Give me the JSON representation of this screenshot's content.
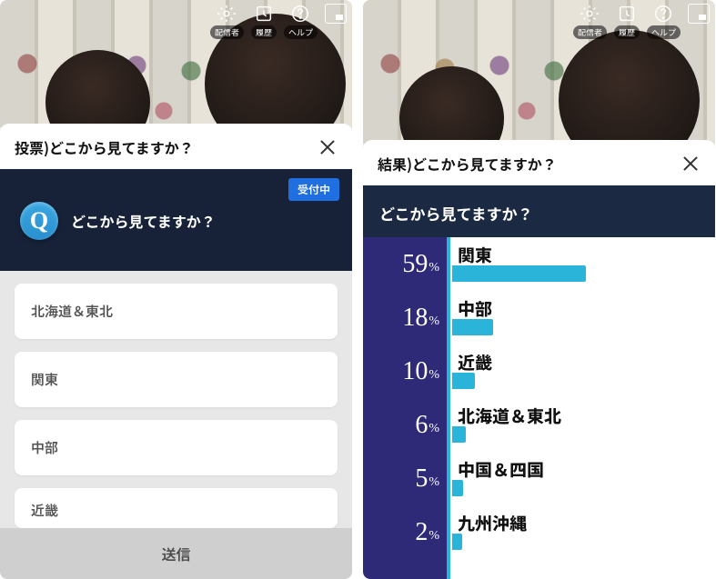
{
  "top_icons": {
    "broadcaster_label": "配信者",
    "history_label": "履歴",
    "help_label": "ヘルプ"
  },
  "left": {
    "sheet_title": "投票)どこから見てますか？",
    "badge": "受付中",
    "q_letter": "Q",
    "question": "どこから見てますか？",
    "options": [
      "北海道＆東北",
      "関東",
      "中部",
      "近畿"
    ],
    "submit": "送信"
  },
  "right": {
    "sheet_title": "結果)どこから見てますか？",
    "question": "どこから見てますか？",
    "pct_suffix": "%"
  },
  "chart_data": {
    "type": "bar",
    "title": "どこから見てますか？",
    "categories": [
      "関東",
      "中部",
      "近畿",
      "北海道＆東北",
      "中国＆四国",
      "九州沖縄"
    ],
    "values": [
      59,
      18,
      10,
      6,
      5,
      2
    ],
    "xlabel": "",
    "ylabel": "%",
    "ylim": [
      0,
      100
    ]
  }
}
